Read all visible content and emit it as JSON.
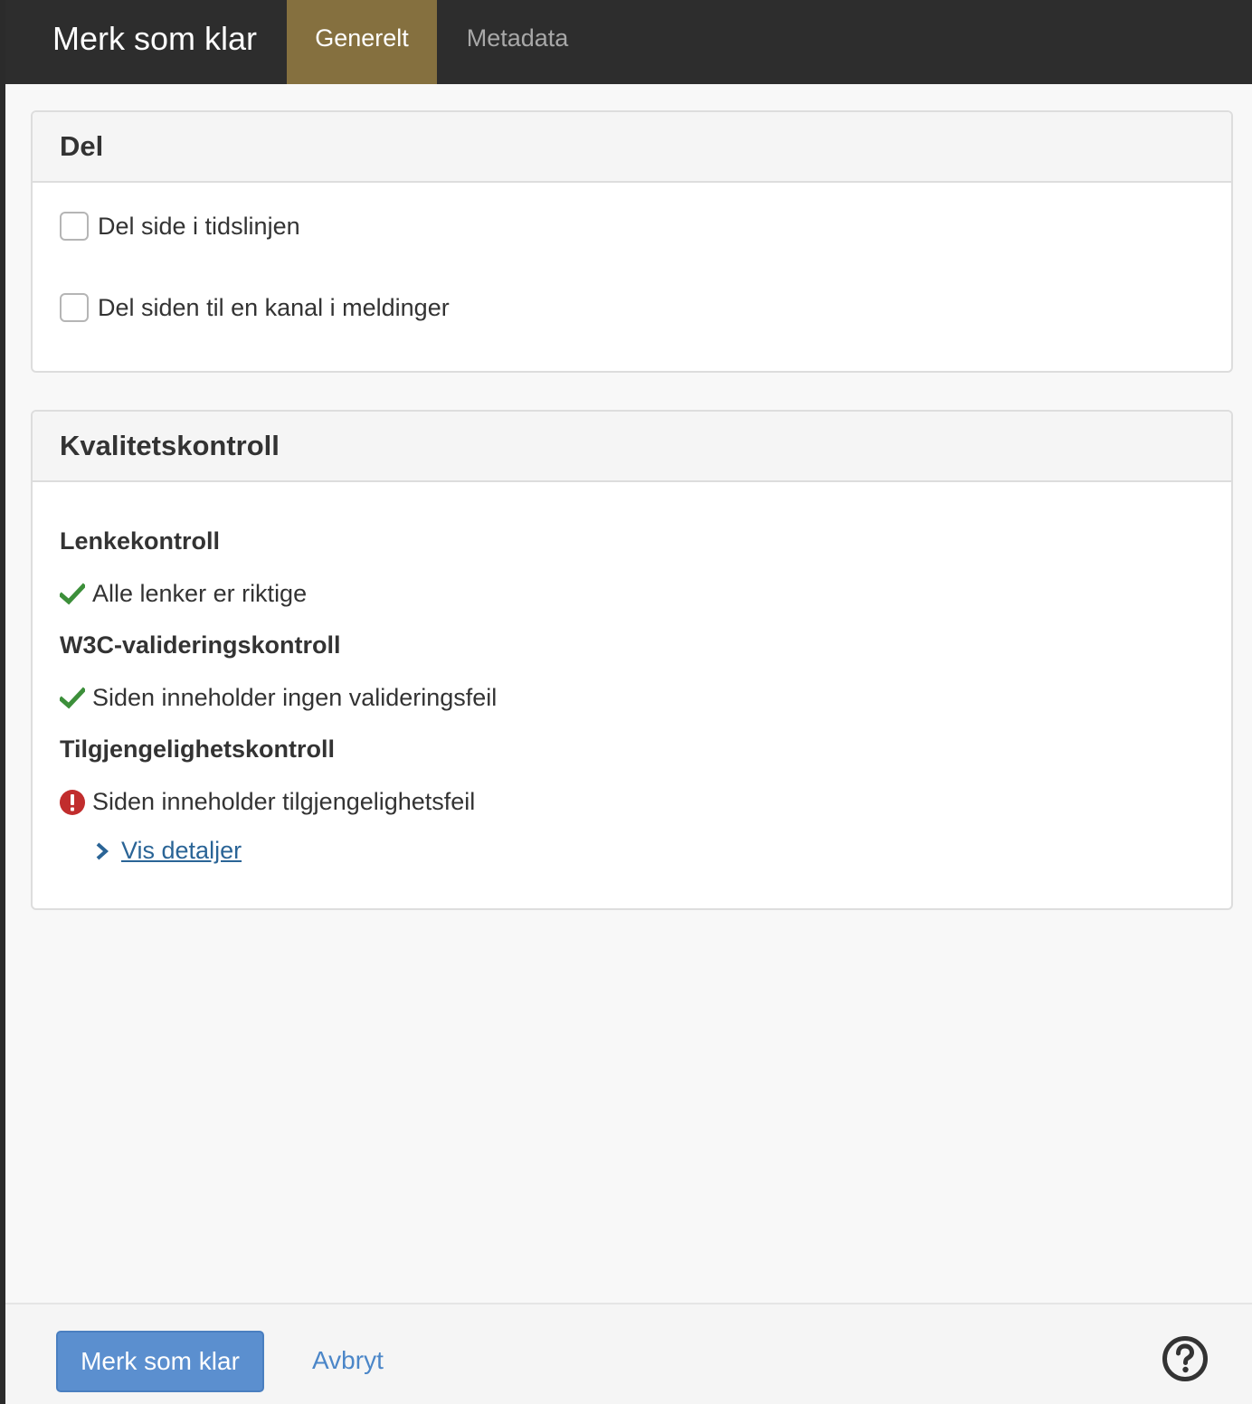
{
  "header": {
    "title": "Merk som klar",
    "tabs": [
      {
        "label": "Generelt",
        "active": true
      },
      {
        "label": "Metadata",
        "active": false
      }
    ]
  },
  "share_panel": {
    "title": "Del",
    "options": [
      {
        "label": "Del side i tidslinjen",
        "checked": false
      },
      {
        "label": "Del siden til en kanal i meldinger",
        "checked": false
      }
    ]
  },
  "quality_panel": {
    "title": "Kvalitetskontroll",
    "checks": [
      {
        "title": "Lenkekontroll",
        "status": "ok",
        "icon": "check-icon",
        "message": "Alle lenker er riktige"
      },
      {
        "title": "W3C-valideringskontroll",
        "status": "ok",
        "icon": "check-icon",
        "message": "Siden inneholder ingen valideringsfeil"
      },
      {
        "title": "Tilgjengelighetskontroll",
        "status": "error",
        "icon": "error-icon",
        "message": "Siden inneholder tilgjengelighetsfeil"
      }
    ],
    "details_link": "Vis detaljer"
  },
  "footer": {
    "confirm_label": "Merk som klar",
    "cancel_label": "Avbryt",
    "help_icon": "help-icon"
  },
  "colors": {
    "header_bg": "#2d2d2d",
    "active_tab": "#85703f",
    "primary_button": "#5b8fcf",
    "ok_green": "#3c8f3a",
    "error_red": "#c12d2d",
    "link_blue": "#2a6496"
  }
}
